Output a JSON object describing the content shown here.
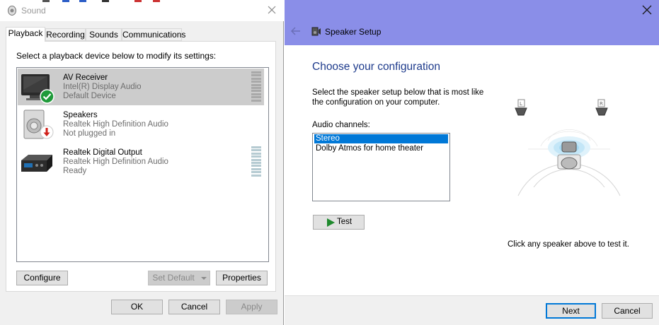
{
  "sound_dialog": {
    "title": "Sound",
    "tabs": [
      {
        "label": "Playback",
        "active": true
      },
      {
        "label": "Recording"
      },
      {
        "label": "Sounds"
      },
      {
        "label": "Communications"
      }
    ],
    "instruction": "Select a playback device below to modify its settings:",
    "devices": [
      {
        "name": "AV Receiver",
        "driver": "Intel(R) Display Audio",
        "status": "Default Device",
        "icon": "monitor-icon",
        "badge": "default-check-icon",
        "selected": true
      },
      {
        "name": "Speakers",
        "driver": "Realtek High Definition Audio",
        "status": "Not plugged in",
        "icon": "speaker-icon",
        "badge": "unplugged-arrow-icon"
      },
      {
        "name": "Realtek Digital Output",
        "driver": "Realtek High Definition Audio",
        "status": "Ready",
        "icon": "digital-output-icon"
      }
    ],
    "buttons": {
      "configure": "Configure",
      "set_default": "Set Default",
      "properties": "Properties",
      "ok": "OK",
      "cancel": "Cancel",
      "apply": "Apply"
    }
  },
  "speaker_setup": {
    "title": "Speaker Setup",
    "heading": "Choose your configuration",
    "description": "Select the speaker setup below that is most like the configuration on your computer.",
    "channels_label": "Audio channels:",
    "channels": [
      {
        "label": "Stereo",
        "selected": true
      },
      {
        "label": "Dolby Atmos for home theater"
      }
    ],
    "test_label": "Test",
    "hint": "Click any speaker above to test it.",
    "speaker_left_label": "L",
    "speaker_right_label": "R",
    "next_label": "Next",
    "cancel_label": "Cancel"
  },
  "colors": {
    "wizard_titlebar": "#8a8ee8",
    "heading": "#1e3b8c",
    "selection": "#0078d7",
    "default_check": "#1f9a3a",
    "unplugged": "#d0201a"
  }
}
